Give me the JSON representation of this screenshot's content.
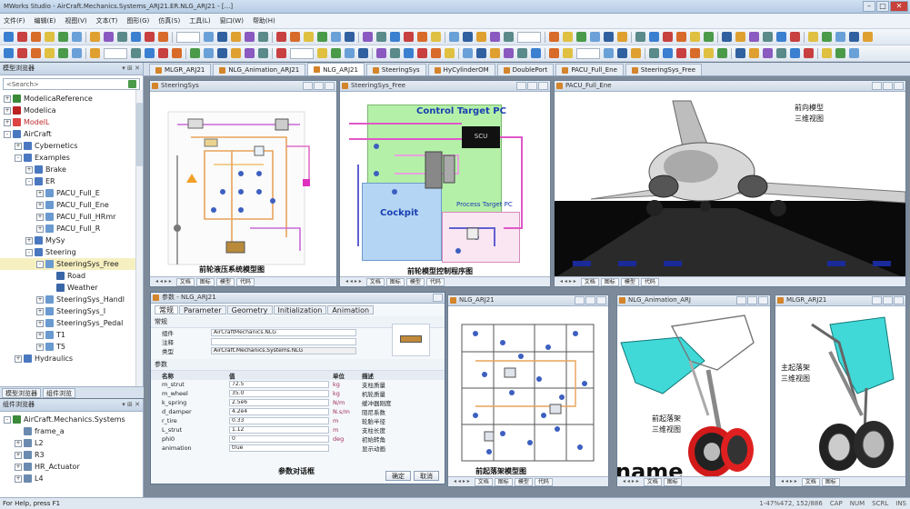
{
  "window": {
    "title": "MWorks Studio - AirCraft.Mechanics.Systems_ARJ21.ER.NLG_ARJ21 - [...]"
  },
  "menu": [
    "文件(F)",
    "编辑(E)",
    "视图(V)",
    "文本(T)",
    "图形(G)",
    "仿真(S)",
    "工具(L)",
    "窗口(W)",
    "帮助(H)"
  ],
  "library_panel": {
    "title": "模型浏览器",
    "search_placeholder": "<Search>",
    "tree": [
      {
        "label": "ModelicaReference",
        "level": 0,
        "expander": "+",
        "icon": "#3a8a3a"
      },
      {
        "label": "Modelica",
        "level": 0,
        "expander": "+",
        "icon": "#b22"
      },
      {
        "label": "ModelL",
        "level": 0,
        "expander": "+",
        "icon": "#d44",
        "style": "red"
      },
      {
        "label": "AirCraft",
        "level": 0,
        "expander": "-",
        "icon": "#4a78c0"
      },
      {
        "label": "Cybernetics",
        "level": 1,
        "expander": "+",
        "icon": "#4a78c0"
      },
      {
        "label": "Examples",
        "level": 1,
        "expander": "-",
        "icon": "#4a78c0"
      },
      {
        "label": "Brake",
        "level": 2,
        "expander": "+",
        "icon": "#4a78c0"
      },
      {
        "label": "ER",
        "level": 2,
        "expander": "-",
        "icon": "#4a78c0"
      },
      {
        "label": "PACU_Full_E",
        "level": 3,
        "expander": "+",
        "icon": "#6a9ad0"
      },
      {
        "label": "PACU_Full_Ene",
        "level": 3,
        "expander": "+",
        "icon": "#6a9ad0"
      },
      {
        "label": "PACU_Full_HRmr",
        "level": 3,
        "expander": "+",
        "icon": "#6a9ad0"
      },
      {
        "label": "PACU_Full_R",
        "level": 3,
        "expander": "+",
        "icon": "#6a9ad0"
      },
      {
        "label": "MySy",
        "level": 2,
        "expander": "+",
        "icon": "#4a78c0"
      },
      {
        "label": "Steering",
        "level": 2,
        "expander": "-",
        "icon": "#4a78c0"
      },
      {
        "label": "SteeringSys_Free",
        "level": 3,
        "expander": "-",
        "icon": "#6a9ad0",
        "style": "sel"
      },
      {
        "label": "Road",
        "level": 4,
        "expander": "",
        "icon": "#3a66a8"
      },
      {
        "label": "Weather",
        "level": 4,
        "expander": "",
        "icon": "#3a66a8"
      },
      {
        "label": "SteeringSys_Handl",
        "level": 3,
        "expander": "+",
        "icon": "#6a9ad0"
      },
      {
        "label": "SteeringSys_I",
        "level": 3,
        "expander": "+",
        "icon": "#6a9ad0"
      },
      {
        "label": "SteeringSys_Pedal",
        "level": 3,
        "expander": "+",
        "icon": "#6a9ad0"
      },
      {
        "label": "T1",
        "level": 3,
        "expander": "+",
        "icon": "#6a9ad0"
      },
      {
        "label": "T5",
        "level": 3,
        "expander": "+",
        "icon": "#6a9ad0"
      },
      {
        "label": "Hydraulics",
        "level": 1,
        "expander": "+",
        "icon": "#4a78c0"
      }
    ],
    "tabs": [
      "模型浏览器",
      "组件浏览"
    ]
  },
  "component_panel": {
    "title": "组件浏览器",
    "tree": [
      {
        "label": "AirCraft.Mechanics.Systems",
        "level": 0,
        "expander": "-"
      },
      {
        "label": "frame_a",
        "level": 1,
        "expander": ""
      },
      {
        "label": "L2",
        "level": 1,
        "expander": "+"
      },
      {
        "label": "R3",
        "level": 1,
        "expander": "+"
      },
      {
        "label": "HR_Actuator",
        "level": 1,
        "expander": "+"
      },
      {
        "label": "L4",
        "level": 1,
        "expander": "+"
      }
    ]
  },
  "doc_tabs": [
    {
      "label": "MLGR_ARJ21",
      "active": false
    },
    {
      "label": "NLG_Animation_ARJ21",
      "active": false
    },
    {
      "label": "NLG_ARJ21",
      "active": true
    },
    {
      "label": "SteeringSys",
      "active": false
    },
    {
      "label": "HyCylinderOM",
      "active": false
    },
    {
      "label": "DoublePort",
      "active": false
    },
    {
      "label": "PACU_Full_Ene",
      "active": false
    },
    {
      "label": "SteeringSys_Free",
      "active": false
    }
  ],
  "windows": {
    "steering": {
      "title": "SteeringSys",
      "caption": "前轮液压系统模型图",
      "footer_tabs": [
        "文档",
        "图标",
        "模型",
        "代码"
      ]
    },
    "free": {
      "title": "SteeringSys_Free",
      "caption": "前轮模型控制程序图",
      "box_label": "Control Target PC",
      "cockpit_label": "Cockpit",
      "chip_label": "SCU",
      "target_label": "Process Target PC",
      "footer_tabs": [
        "文档",
        "图标",
        "模型",
        "代码"
      ]
    },
    "pacu": {
      "title": "PACU_Full_Ene",
      "caption_line1": "前向模型",
      "caption_line2": "三维视图",
      "footer_tabs": [
        "文档",
        "图标",
        "模型",
        "代码"
      ]
    },
    "nlg": {
      "title": "NLG_ARJ21",
      "caption": "前起落架模型图",
      "footer_tabs": [
        "文档",
        "图标",
        "模型",
        "代码"
      ]
    },
    "nlg_anim": {
      "title": "NLG_Animation_ARJ",
      "caption_line1": "前起落架",
      "caption_line2": "三维视图",
      "overlay_text": "name",
      "footer_tabs": [
        "文档",
        "图标"
      ]
    },
    "mlg": {
      "title": "MLGR_ARJ21",
      "caption_line1": "主起落架",
      "caption_line2": "三维视图",
      "footer_tabs": [
        "文档",
        "图标"
      ]
    }
  },
  "param_dialog": {
    "title": "参数 - NLG_ARJ21",
    "tabs": [
      "常规",
      "Parameter",
      "Geometry",
      "Initialization",
      "Animation"
    ],
    "general_group": "常规",
    "name_label": "组件",
    "name_value": "AirCraftMechanics.NLG",
    "comment_label": "注释",
    "class_label": "类型",
    "class_value": "AirCraft.Mechanics.Systems.NLG",
    "params_group": "参数",
    "columns": [
      "名称",
      "值",
      "单位",
      "描述"
    ],
    "rows": [
      {
        "name": "m_strut",
        "value": "72.5",
        "unit": "kg",
        "desc": "支柱质量"
      },
      {
        "name": "m_wheel",
        "value": "35.0",
        "unit": "kg",
        "desc": "机轮质量"
      },
      {
        "name": "k_spring",
        "value": "2.5e6",
        "unit": "N/m",
        "desc": "缓冲器刚度"
      },
      {
        "name": "d_damper",
        "value": "4.2e4",
        "unit": "N.s/m",
        "desc": "阻尼系数"
      },
      {
        "name": "r_tire",
        "value": "0.33",
        "unit": "m",
        "desc": "轮胎半径"
      },
      {
        "name": "L_strut",
        "value": "1.12",
        "unit": "m",
        "desc": "支柱长度"
      },
      {
        "name": "phi0",
        "value": "0",
        "unit": "deg",
        "desc": "初始转角"
      },
      {
        "name": "animation",
        "value": "true",
        "unit": "",
        "desc": "显示动画"
      }
    ],
    "caption": "参数对话框",
    "ok_label": "确定",
    "cancel_label": "取消"
  },
  "statusbar": {
    "left": "For Help, press F1",
    "coords": "1-47%472, 152/886",
    "indicators": [
      "CAP",
      "NUM",
      "SCRL",
      "INS"
    ]
  }
}
